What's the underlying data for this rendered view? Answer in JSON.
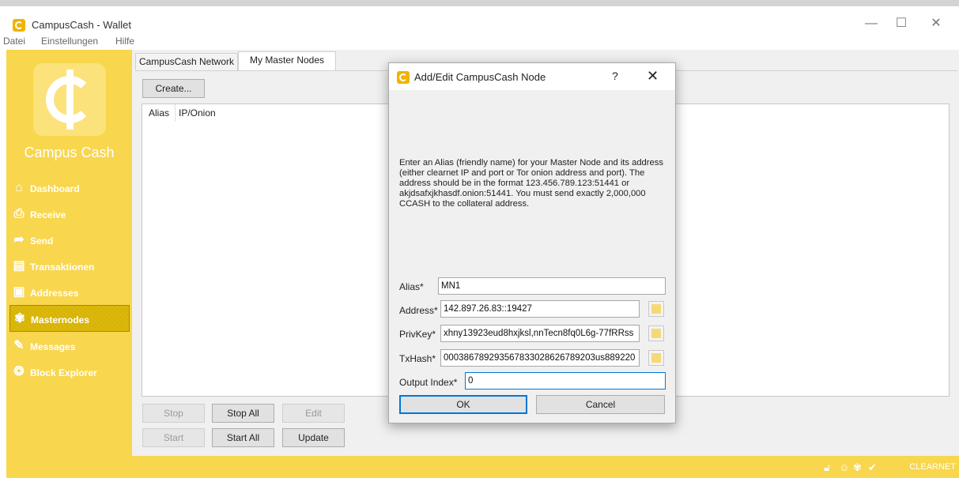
{
  "window": {
    "title": "CampusCash - Wallet",
    "controls": {
      "minimize": "—",
      "maximize": "☐",
      "close": "✕"
    }
  },
  "menu": [
    "Datei",
    "Einstellungen",
    "Hilfe"
  ],
  "sidebar": {
    "brand": "Campus Cash",
    "items": [
      {
        "label": "Dashboard",
        "icon": "home-icon"
      },
      {
        "label": "Receive",
        "icon": "inbox-icon"
      },
      {
        "label": "Send",
        "icon": "send-arrow-icon"
      },
      {
        "label": "Transaktionen",
        "icon": "transactions-icon"
      },
      {
        "label": "Addresses",
        "icon": "address-book-icon"
      },
      {
        "label": "Masternodes",
        "icon": "masternodes-icon",
        "active": true
      },
      {
        "label": "Messages",
        "icon": "pen-icon"
      },
      {
        "label": "Block Explorer",
        "icon": "cube-network-icon"
      }
    ]
  },
  "tabs": [
    {
      "label": "CampusCash Network",
      "active": false
    },
    {
      "label": "My Master Nodes",
      "active": true
    }
  ],
  "main": {
    "create_label": "Create...",
    "columns": [
      "Alias",
      "IP/Onion"
    ],
    "buttons": {
      "stop": "Stop",
      "stop_all": "Stop All",
      "edit": "Edit",
      "start": "Start",
      "start_all": "Start All",
      "update": "Update"
    }
  },
  "dialog": {
    "title": "Add/Edit CampusCash Node",
    "help": "?",
    "close": "✕",
    "description": "Enter an Alias (friendly name) for your Master Node and its address (either clearnet IP and port or Tor onion address and port). The address should be in the format 123.456.789.123:51441 or akjdsafxjkhasdf.onion:51441. You must send exactly 2,000,000 CCASH to the collateral address.",
    "fields": {
      "alias": {
        "label": "Alias*",
        "value": "MN1"
      },
      "address": {
        "label": "Address*",
        "value": "142.897.26.83::19427"
      },
      "privkey": {
        "label": "PrivKey*",
        "value": "xhny13923eud8hxjksl,nnTecn8fq0L6g-77fRRss"
      },
      "txhash": {
        "label": "TxHash*",
        "value": "000386789293567833028626789203us889220"
      },
      "output_index": {
        "label": "Output Index*",
        "value": "0"
      }
    },
    "ok_label": "OK",
    "cancel_label": "Cancel"
  },
  "statusbar": {
    "network": "CLEARNET"
  },
  "colors": {
    "accent": "#f8d64e",
    "accent_dark": "#d8b300",
    "focus": "#0078d7"
  }
}
